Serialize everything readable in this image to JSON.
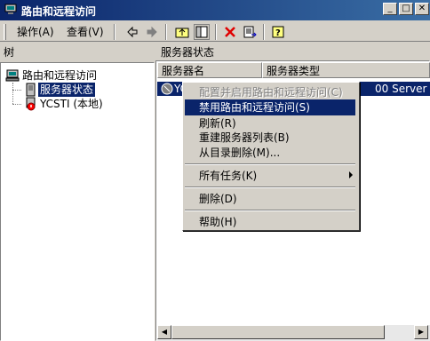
{
  "window": {
    "title": "路由和远程访问"
  },
  "menubar": {
    "action": "操作(A)",
    "view": "查看(V)"
  },
  "tree": {
    "header": "树",
    "root": "路由和远程访问",
    "items": [
      {
        "label": "服务器状态",
        "selected": true
      },
      {
        "label": "YCSTI (本地)",
        "selected": false
      }
    ]
  },
  "main": {
    "header": "服务器状态",
    "columns": [
      "服务器名",
      "服务器类型"
    ],
    "row": {
      "name": "YC",
      "type": "00 Server"
    }
  },
  "context_menu": {
    "items": [
      {
        "label": "配置并启用路由和远程访问(C)",
        "disabled": true
      },
      {
        "label": "禁用路由和远程访问(S)",
        "highlighted": true
      },
      {
        "label": "刷新(R)"
      },
      {
        "label": "重建服务器列表(B)"
      },
      {
        "label": "从目录删除(M)..."
      },
      {
        "label": "所有任务(K)",
        "submenu": true
      },
      {
        "label": "删除(D)"
      },
      {
        "label": "帮助(H)"
      }
    ]
  },
  "colors": {
    "title_start": "#0a246a",
    "title_end": "#3a6ea5",
    "selection": "#0a246a"
  }
}
